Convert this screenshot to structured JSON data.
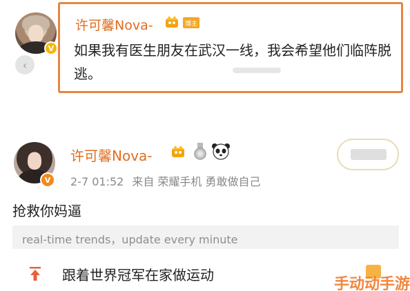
{
  "highlighted_post": {
    "username": "许可馨Nova-",
    "tag": "博主",
    "text": "如果我有医生朋友在武汉一线，我会希望他们临阵脱逃。"
  },
  "post": {
    "username": "许可馨Nova-",
    "time": "2-7 01:52",
    "source": "来自 荣耀手机 勇敢做自己",
    "body": "抢救你妈逼"
  },
  "trend_banner": "real-time trends，update every minute",
  "trend_item": "跟着世界冠军在家做运动",
  "watermark": "手动动手游",
  "colors": {
    "accent_orange": "#e9843f",
    "username_orange": "#e06d1f",
    "verified_yellow": "#f7b500"
  }
}
